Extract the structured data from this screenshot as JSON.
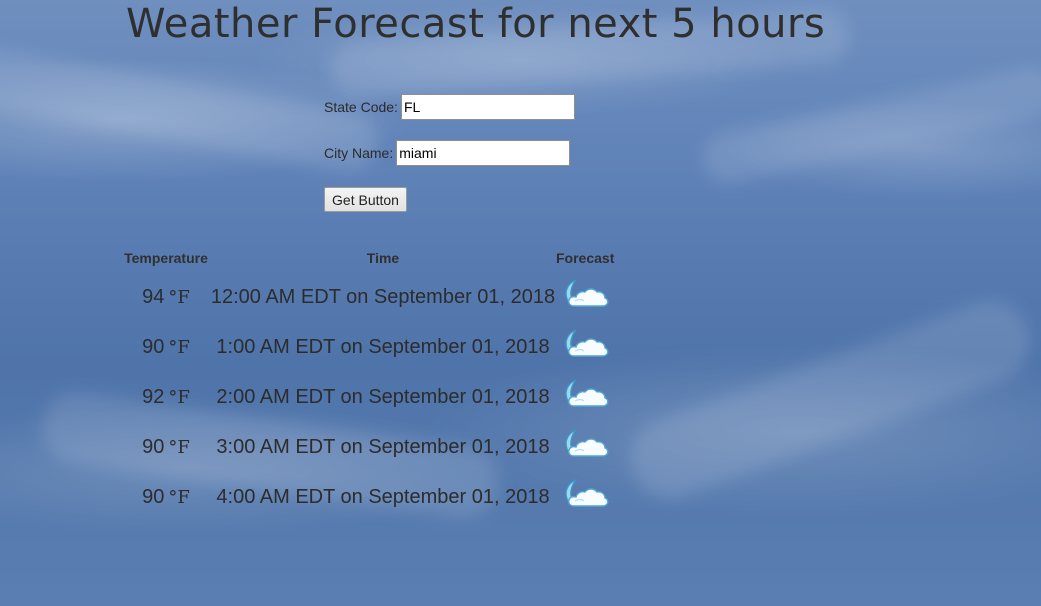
{
  "page": {
    "title": "Weather Forecast for next 5 hours"
  },
  "form": {
    "state_label": "State Code:",
    "state_value": "FL",
    "city_label": "City Name:",
    "city_value": "miami",
    "button_label": "Get Button"
  },
  "table": {
    "headers": {
      "temperature": "Temperature",
      "time": "Time",
      "forecast": "Forecast"
    },
    "rows": [
      {
        "temp": "94",
        "unit": "°F",
        "time": "12:00 AM EDT on September 01, 2018",
        "icon": "partly-cloudy-night-icon"
      },
      {
        "temp": "90",
        "unit": "°F",
        "time": "1:00 AM EDT on September 01, 2018",
        "icon": "partly-cloudy-night-icon"
      },
      {
        "temp": "92",
        "unit": "°F",
        "time": "2:00 AM EDT on September 01, 2018",
        "icon": "partly-cloudy-night-icon"
      },
      {
        "temp": "90",
        "unit": "°F",
        "time": "3:00 AM EDT on September 01, 2018",
        "icon": "partly-cloudy-night-icon"
      },
      {
        "temp": "90",
        "unit": "°F",
        "time": "4:00 AM EDT on September 01, 2018",
        "icon": "partly-cloudy-night-icon"
      }
    ]
  }
}
